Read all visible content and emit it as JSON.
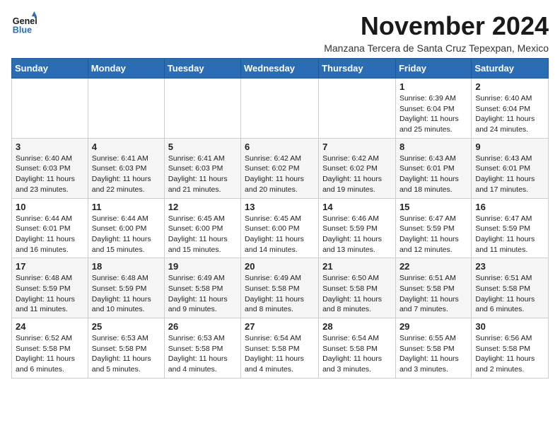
{
  "logo": {
    "text_general": "General",
    "text_blue": "Blue"
  },
  "header": {
    "month_year": "November 2024",
    "subtitle": "Manzana Tercera de Santa Cruz Tepexpan, Mexico"
  },
  "days_of_week": [
    "Sunday",
    "Monday",
    "Tuesday",
    "Wednesday",
    "Thursday",
    "Friday",
    "Saturday"
  ],
  "weeks": [
    [
      {
        "day": "",
        "info": ""
      },
      {
        "day": "",
        "info": ""
      },
      {
        "day": "",
        "info": ""
      },
      {
        "day": "",
        "info": ""
      },
      {
        "day": "",
        "info": ""
      },
      {
        "day": "1",
        "info": "Sunrise: 6:39 AM\nSunset: 6:04 PM\nDaylight: 11 hours and 25 minutes."
      },
      {
        "day": "2",
        "info": "Sunrise: 6:40 AM\nSunset: 6:04 PM\nDaylight: 11 hours and 24 minutes."
      }
    ],
    [
      {
        "day": "3",
        "info": "Sunrise: 6:40 AM\nSunset: 6:03 PM\nDaylight: 11 hours and 23 minutes."
      },
      {
        "day": "4",
        "info": "Sunrise: 6:41 AM\nSunset: 6:03 PM\nDaylight: 11 hours and 22 minutes."
      },
      {
        "day": "5",
        "info": "Sunrise: 6:41 AM\nSunset: 6:03 PM\nDaylight: 11 hours and 21 minutes."
      },
      {
        "day": "6",
        "info": "Sunrise: 6:42 AM\nSunset: 6:02 PM\nDaylight: 11 hours and 20 minutes."
      },
      {
        "day": "7",
        "info": "Sunrise: 6:42 AM\nSunset: 6:02 PM\nDaylight: 11 hours and 19 minutes."
      },
      {
        "day": "8",
        "info": "Sunrise: 6:43 AM\nSunset: 6:01 PM\nDaylight: 11 hours and 18 minutes."
      },
      {
        "day": "9",
        "info": "Sunrise: 6:43 AM\nSunset: 6:01 PM\nDaylight: 11 hours and 17 minutes."
      }
    ],
    [
      {
        "day": "10",
        "info": "Sunrise: 6:44 AM\nSunset: 6:01 PM\nDaylight: 11 hours and 16 minutes."
      },
      {
        "day": "11",
        "info": "Sunrise: 6:44 AM\nSunset: 6:00 PM\nDaylight: 11 hours and 15 minutes."
      },
      {
        "day": "12",
        "info": "Sunrise: 6:45 AM\nSunset: 6:00 PM\nDaylight: 11 hours and 15 minutes."
      },
      {
        "day": "13",
        "info": "Sunrise: 6:45 AM\nSunset: 6:00 PM\nDaylight: 11 hours and 14 minutes."
      },
      {
        "day": "14",
        "info": "Sunrise: 6:46 AM\nSunset: 5:59 PM\nDaylight: 11 hours and 13 minutes."
      },
      {
        "day": "15",
        "info": "Sunrise: 6:47 AM\nSunset: 5:59 PM\nDaylight: 11 hours and 12 minutes."
      },
      {
        "day": "16",
        "info": "Sunrise: 6:47 AM\nSunset: 5:59 PM\nDaylight: 11 hours and 11 minutes."
      }
    ],
    [
      {
        "day": "17",
        "info": "Sunrise: 6:48 AM\nSunset: 5:59 PM\nDaylight: 11 hours and 11 minutes."
      },
      {
        "day": "18",
        "info": "Sunrise: 6:48 AM\nSunset: 5:59 PM\nDaylight: 11 hours and 10 minutes."
      },
      {
        "day": "19",
        "info": "Sunrise: 6:49 AM\nSunset: 5:58 PM\nDaylight: 11 hours and 9 minutes."
      },
      {
        "day": "20",
        "info": "Sunrise: 6:49 AM\nSunset: 5:58 PM\nDaylight: 11 hours and 8 minutes."
      },
      {
        "day": "21",
        "info": "Sunrise: 6:50 AM\nSunset: 5:58 PM\nDaylight: 11 hours and 8 minutes."
      },
      {
        "day": "22",
        "info": "Sunrise: 6:51 AM\nSunset: 5:58 PM\nDaylight: 11 hours and 7 minutes."
      },
      {
        "day": "23",
        "info": "Sunrise: 6:51 AM\nSunset: 5:58 PM\nDaylight: 11 hours and 6 minutes."
      }
    ],
    [
      {
        "day": "24",
        "info": "Sunrise: 6:52 AM\nSunset: 5:58 PM\nDaylight: 11 hours and 6 minutes."
      },
      {
        "day": "25",
        "info": "Sunrise: 6:53 AM\nSunset: 5:58 PM\nDaylight: 11 hours and 5 minutes."
      },
      {
        "day": "26",
        "info": "Sunrise: 6:53 AM\nSunset: 5:58 PM\nDaylight: 11 hours and 4 minutes."
      },
      {
        "day": "27",
        "info": "Sunrise: 6:54 AM\nSunset: 5:58 PM\nDaylight: 11 hours and 4 minutes."
      },
      {
        "day": "28",
        "info": "Sunrise: 6:54 AM\nSunset: 5:58 PM\nDaylight: 11 hours and 3 minutes."
      },
      {
        "day": "29",
        "info": "Sunrise: 6:55 AM\nSunset: 5:58 PM\nDaylight: 11 hours and 3 minutes."
      },
      {
        "day": "30",
        "info": "Sunrise: 6:56 AM\nSunset: 5:58 PM\nDaylight: 11 hours and 2 minutes."
      }
    ]
  ]
}
